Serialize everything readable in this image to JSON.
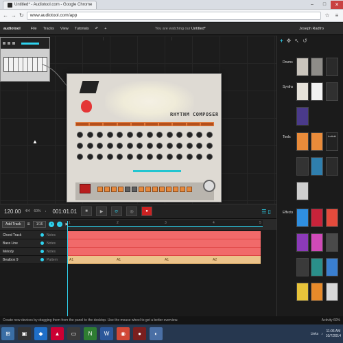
{
  "browser": {
    "tab_title": "Untitled* - Audiotool.com - Google Chrome",
    "url": "www.audiotool.com/app"
  },
  "app": {
    "logo": "audiotool",
    "menu": [
      "File",
      "Tracks",
      "View",
      "Tutorials"
    ],
    "watching_prefix": "You are watching our",
    "watching_doc": "Untitled*",
    "user": "Joseph Radfro"
  },
  "drum_machine": {
    "title": "RHYTHM COMPOSER"
  },
  "right_panel": {
    "sections": [
      "Drums",
      "Synths",
      "Tools",
      "Effects"
    ],
    "tool_tile_label": "ImAdd"
  },
  "transport": {
    "bpm": "120.00",
    "signature": "4/4",
    "swing": "60%",
    "position": "001:01.01"
  },
  "sequencer": {
    "add_track": "Add Track",
    "quantize": "1/16",
    "timeline_marks": [
      "1",
      "2",
      "3",
      "4",
      "5"
    ],
    "tracks": [
      {
        "name": "Chord Track",
        "kind": "Notes"
      },
      {
        "name": "Bass Line",
        "kind": "Notes"
      },
      {
        "name": "Melody",
        "kind": "Notes"
      },
      {
        "name": "Beatbox 9",
        "kind": "Pattern"
      }
    ],
    "pattern_labels": [
      "A1",
      "A1",
      "A1",
      "A2"
    ]
  },
  "status": {
    "hint": "Create new devices by dragging them from the panel to the desktop. Use the mouse wheel to get a better overview.",
    "activity": "Activity 60%"
  },
  "taskbar": {
    "links": "Links",
    "time": "11:06 AM",
    "date": "10/7/2014"
  },
  "colors": {
    "accent": "#2fd3ef",
    "notes_region": "#f16a6a",
    "pattern_region": "#ecc38a"
  }
}
